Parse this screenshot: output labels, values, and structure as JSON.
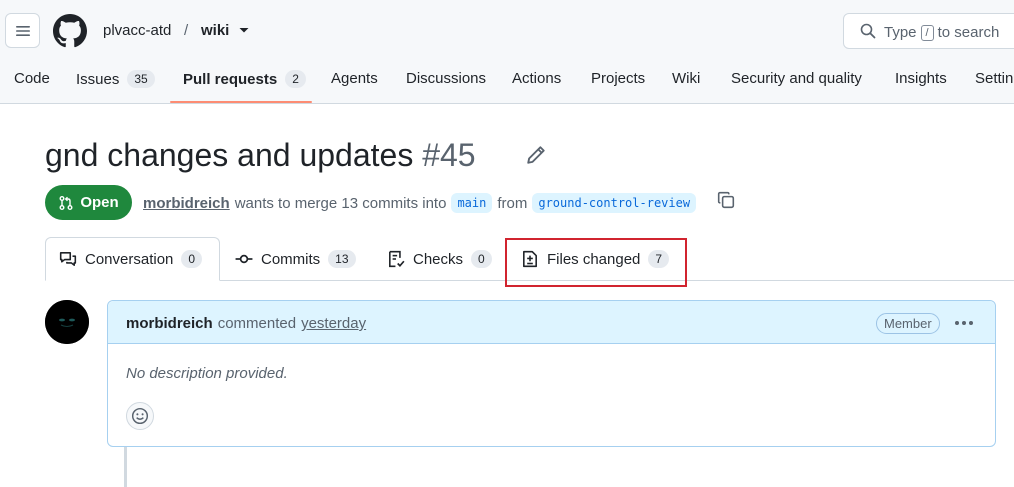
{
  "header": {
    "owner": "plvacc-atd",
    "separator": "/",
    "repo": "wiki",
    "search": {
      "prefix": "Type",
      "key": "/",
      "suffix": "to search"
    }
  },
  "nav": {
    "items": [
      {
        "label": "Code",
        "count": ""
      },
      {
        "label": "Issues",
        "count": "35"
      },
      {
        "label": "Pull requests",
        "count": "2",
        "active": true
      },
      {
        "label": "Agents",
        "count": ""
      },
      {
        "label": "Discussions",
        "count": ""
      },
      {
        "label": "Actions",
        "count": ""
      },
      {
        "label": "Projects",
        "count": ""
      },
      {
        "label": "Wiki",
        "count": ""
      },
      {
        "label": "Security and quality",
        "count": ""
      },
      {
        "label": "Insights",
        "count": ""
      },
      {
        "label": "Settin",
        "count": ""
      }
    ]
  },
  "pr": {
    "title": "gnd changes and updates",
    "number": "#45",
    "state": "Open",
    "author": "morbidreich",
    "merge_text_1": "wants to merge 13 commits into",
    "base_branch": "main",
    "from_text": "from",
    "head_branch": "ground-control-review"
  },
  "tabs": [
    {
      "label": "Conversation",
      "count": "0"
    },
    {
      "label": "Commits",
      "count": "13"
    },
    {
      "label": "Checks",
      "count": "0"
    },
    {
      "label": "Files changed",
      "count": "7"
    }
  ],
  "comment": {
    "author": "morbidreich",
    "action": "commented",
    "time": "yesterday",
    "role": "Member",
    "body": "No description provided."
  },
  "colors": {
    "open_green": "#1f883d",
    "link_blue": "#0969da",
    "highlight_red": "#d1242f",
    "nav_underline": "#fd8c73"
  }
}
